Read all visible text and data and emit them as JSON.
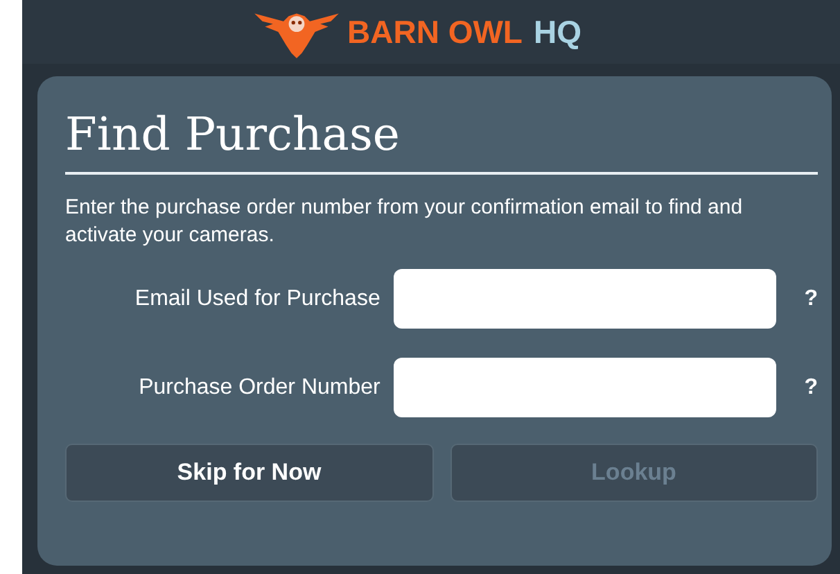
{
  "header": {
    "brand": "BARN OWL",
    "brand_suffix": "HQ"
  },
  "dialog": {
    "title": "Find Purchase",
    "description": "Enter the purchase order number from your confirmation email to find and activate your cameras.",
    "fields": [
      {
        "label": "Email Used for Purchase",
        "help": "?"
      },
      {
        "label": "Purchase Order Number",
        "help": "?"
      }
    ],
    "buttons": [
      {
        "label": "Skip for Now",
        "disabled": false
      },
      {
        "label": "Lookup",
        "disabled": true
      }
    ]
  }
}
